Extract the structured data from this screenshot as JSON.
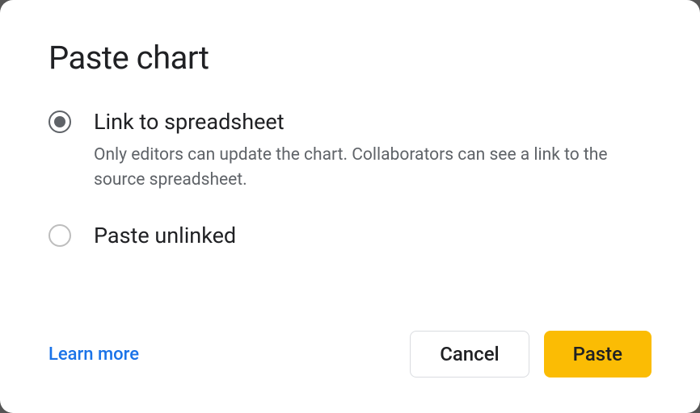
{
  "dialog": {
    "title": "Paste chart",
    "options": [
      {
        "label": "Link to spreadsheet",
        "description": "Only editors can update the chart. Collaborators can see a link to the source spreadsheet.",
        "selected": true
      },
      {
        "label": "Paste unlinked",
        "description": "",
        "selected": false
      }
    ],
    "learn_more": "Learn more",
    "cancel_label": "Cancel",
    "paste_label": "Paste"
  }
}
